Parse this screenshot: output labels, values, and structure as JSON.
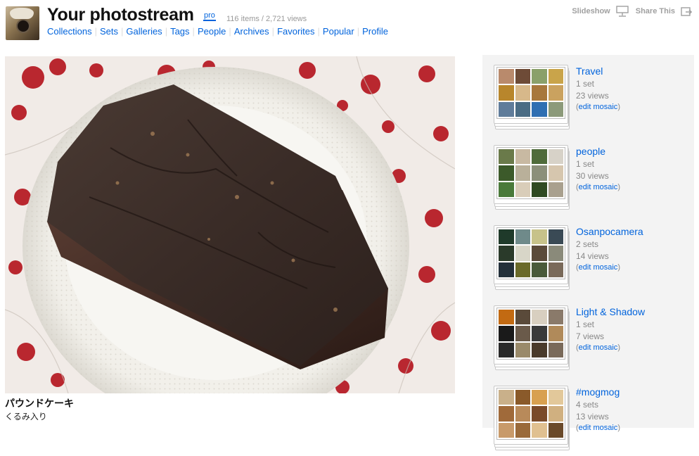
{
  "header": {
    "title": "Your photostream",
    "pro_label": "pro",
    "stats": "116 items / 2,721 views",
    "nav": [
      "Collections",
      "Sets",
      "Galleries",
      "Tags",
      "People",
      "Archives",
      "Favorites",
      "Popular",
      "Profile"
    ],
    "slideshow_label": "Slideshow",
    "share_label": "Share This"
  },
  "photo": {
    "title": "パウンドケーキ",
    "description": "くるみ入り"
  },
  "colors": {
    "link": "#0063dc",
    "muted": "#999999",
    "sidebar_bg": "#f3f3f3"
  },
  "sets": [
    {
      "title": "Travel",
      "count": "1 set",
      "views": "23 views",
      "edit_open": "(",
      "edit_link": "edit mosaic",
      "edit_close": ")",
      "tiles": [
        "#b98a6c",
        "#6e4b37",
        "#8aa06a",
        "#c9a44a",
        "#b8862c",
        "#d7b88a",
        "#a7773c",
        "#caa25f",
        "#5f7c9a",
        "#4a6c84",
        "#2f6fb2",
        "#8c9a7a"
      ]
    },
    {
      "title": "people",
      "count": "1 set",
      "views": "30 views",
      "edit_open": "(",
      "edit_link": "edit mosaic",
      "edit_close": ")",
      "tiles": [
        "#6a7a4a",
        "#c8b9a2",
        "#4f6b3a",
        "#d7d2c8",
        "#3c5a2a",
        "#b9b09a",
        "#8b8f7a",
        "#d6c6ae",
        "#4a7a3a",
        "#d9cdb9",
        "#2f4a22",
        "#a9a08e"
      ]
    },
    {
      "title": "Osanpocamera",
      "count": "2 sets",
      "views": "14 views",
      "edit_open": "(",
      "edit_link": "edit mosaic",
      "edit_close": ")",
      "tiles": [
        "#1f3a2a",
        "#6f8a8a",
        "#c7c28a",
        "#3a4a55",
        "#2a3a2a",
        "#d8d6c8",
        "#5a4a3a",
        "#8a8a7a",
        "#23303a",
        "#6a6a2a",
        "#4a5a3a",
        "#7a6a5a"
      ]
    },
    {
      "title": "Light & Shadow",
      "count": "1 set",
      "views": "7 views",
      "edit_open": "(",
      "edit_link": "edit mosaic",
      "edit_close": ")",
      "tiles": [
        "#c26a12",
        "#5a4a3a",
        "#d8cfc0",
        "#8a7a6a",
        "#1a1a1a",
        "#6a5a4a",
        "#3a3a3a",
        "#b08a5a",
        "#2a2a2a",
        "#9a8a6a",
        "#4a3a2a",
        "#7a6a5a"
      ]
    },
    {
      "title": "#mogmog",
      "count": "4 sets",
      "views": "13 views",
      "edit_open": "(",
      "edit_link": "edit mosaic",
      "edit_close": ")",
      "tiles": [
        "#c9b08a",
        "#8a5a2a",
        "#d8a050",
        "#e2c89a",
        "#a06a3a",
        "#b88a5a",
        "#7a4a2a",
        "#d0b080",
        "#c89a6a",
        "#9a6a3a",
        "#e0c090",
        "#6a4a2a"
      ]
    }
  ]
}
